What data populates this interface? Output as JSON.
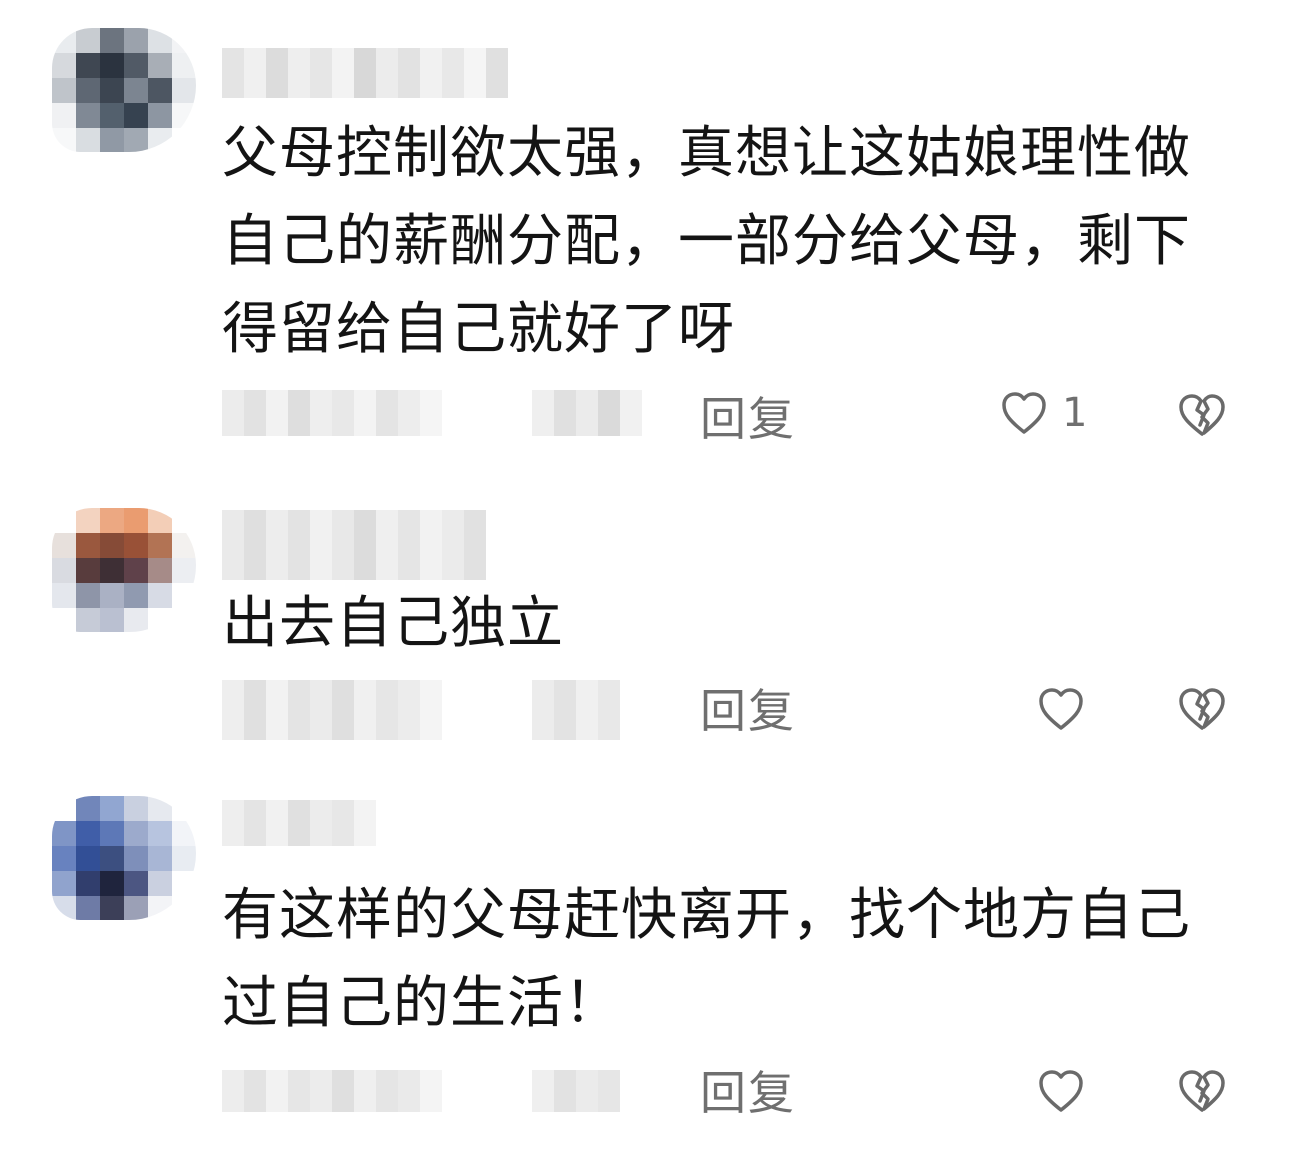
{
  "comments": [
    {
      "text": "父母控制欲太强，真想让这姑娘理性做\n自己的薪酬分配，一部分给父母，剩下\n得留给自己就好了呀",
      "reply_label": "回复",
      "like_count": "1",
      "avatar_colors": [
        "#e9ecef",
        "#c8ccd2",
        "#6b7480",
        "#9aa2ad",
        "#dde1e6",
        "#f2f3f5",
        "#d6d9de",
        "#3e4753",
        "#2a3340",
        "#505a67",
        "#a7aeb7",
        "#eef0f2",
        "#bfc4cb",
        "#5d6774",
        "#3b4552",
        "#7b8592",
        "#4c5663",
        "#e3e6ea",
        "#f0f1f3",
        "#7f8996",
        "#52606f",
        "#354252",
        "#8c96a3",
        "#f6f7f8",
        "#f7f8f9",
        "#d9dde2",
        "#8f99a6",
        "#a0a9b4",
        "#e9ecef",
        "#ffffff"
      ]
    },
    {
      "text": "出去自己独立",
      "reply_label": "回复",
      "like_count": "",
      "avatar_colors": [
        "#ffffff",
        "#f6d2bd",
        "#f2a77d",
        "#f19a6a",
        "#f6cdb4",
        "#ffffff",
        "#e8e0db",
        "#a0573a",
        "#8b4a34",
        "#a04f33",
        "#b8724f",
        "#f3f1ef",
        "#d9dbe2",
        "#5b3b3c",
        "#3f2f35",
        "#62404a",
        "#a88a87",
        "#eceef2",
        "#e4e7ee",
        "#8d95aa",
        "#a9b1c6",
        "#8f9ab2",
        "#d7dbe6",
        "#ffffff",
        "#ffffff",
        "#c6cbd8",
        "#b9c0d3",
        "#e8eaf0",
        "#ffffff",
        "#ffffff"
      ]
    },
    {
      "text": "有这样的父母赶快离开，找个地方自己\n过自己的生活！",
      "reply_label": "回复",
      "like_count": "",
      "avatar_colors": [
        "#ffffff",
        "#6f86c0",
        "#8fa6d6",
        "#c8d0e2",
        "#e6e9f0",
        "#ffffff",
        "#7d95cc",
        "#3d5eb0",
        "#5a78be",
        "#9aaad0",
        "#b6c4e2",
        "#f2f4f8",
        "#6582c6",
        "#2f4f9e",
        "#3a4f86",
        "#7c8fbf",
        "#a6b6d8",
        "#e8ecf3",
        "#8ea3d2",
        "#2f3e72",
        "#1e2440",
        "#4b5687",
        "#c9d0e2",
        "#ffffff",
        "#d6ddec",
        "#6d7bab",
        "#3b3f5b",
        "#9aa0b8",
        "#f3f4f7",
        "#ffffff"
      ]
    }
  ]
}
